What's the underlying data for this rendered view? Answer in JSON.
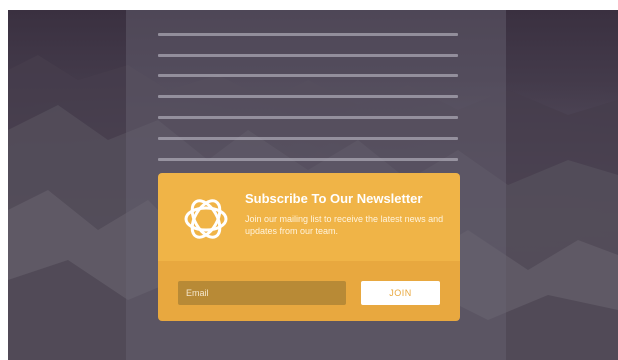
{
  "newsletter": {
    "title": "Subscribe To Our Newsletter",
    "description": "Join our mailing list to receive the latest news and updates from our team.",
    "email_placeholder": "Email",
    "join_label": "JOIN",
    "logo_icon": "interlocking-rings-logo-icon"
  },
  "colors": {
    "card_accent": "#f0b447",
    "card_footer": "#e8a83f",
    "input_bg": "#b88a36"
  }
}
